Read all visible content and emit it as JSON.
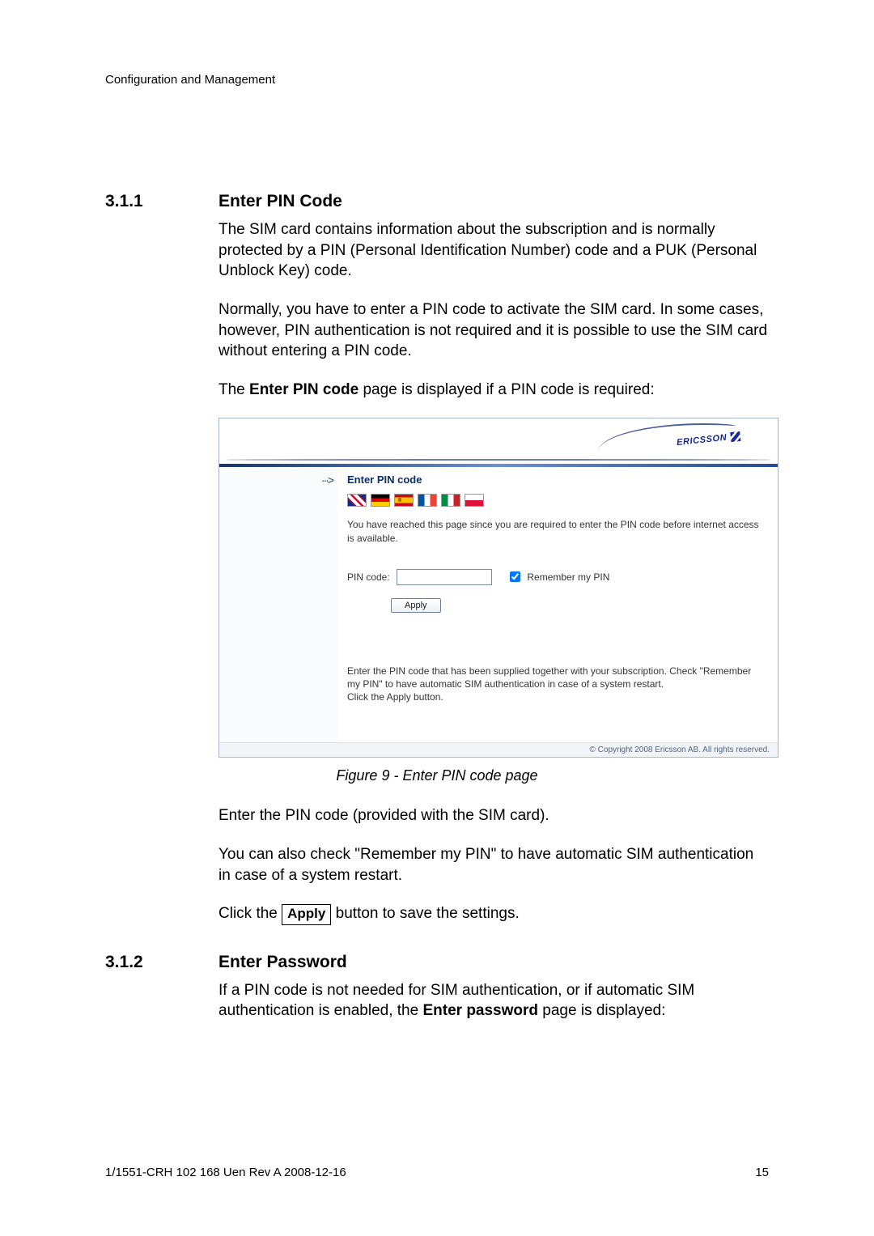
{
  "header": "Configuration and Management",
  "section311": {
    "number": "3.1.1",
    "title": "Enter PIN Code",
    "para1": "The SIM card contains information about the subscription and is normally protected by a PIN (Personal Identification Number) code and a PUK (Personal Unblock Key) code.",
    "para2": "Normally, you have to enter a PIN code to activate the SIM card. In some cases, however, PIN authentication is not required and it is possible to use the SIM card without entering a PIN code.",
    "para3a": "The ",
    "para3b_bold": "Enter PIN code",
    "para3c": " page is displayed if a PIN code is required:"
  },
  "shot": {
    "logo_text": "ERICSSON",
    "nav_arrow": "···>",
    "title": "Enter PIN code",
    "intro": "You have reached this page since you are required to enter the PIN code before internet access is available.",
    "pin_label": "PIN code:",
    "pin_value": "",
    "remember_label": "Remember my PIN",
    "apply_label": "Apply",
    "help1": "Enter the PIN code that has been supplied together with your subscription. Check \"Remember my PIN\" to have automatic SIM authentication in case of a system restart.",
    "help2": "Click the Apply button.",
    "footer": "© Copyright 2008 Ericsson AB. All rights reserved."
  },
  "caption": "Figure 9 - Enter PIN code page",
  "after": {
    "p1": "Enter the PIN code (provided with the SIM card).",
    "p2": "You can also check \"Remember my PIN\" to have automatic SIM authentication in case of a system restart.",
    "p3a": "Click the ",
    "p3_btn": "Apply",
    "p3b": " button to save the settings."
  },
  "section312": {
    "number": "3.1.2",
    "title": "Enter Password",
    "para_a": "If a PIN code is not needed for SIM authentication, or if automatic SIM authentication is enabled, the ",
    "para_bold": "Enter password",
    "para_b": " page is displayed:"
  },
  "footer": {
    "left": "1/1551-CRH 102 168 Uen Rev A  2008-12-16",
    "right": "15"
  }
}
